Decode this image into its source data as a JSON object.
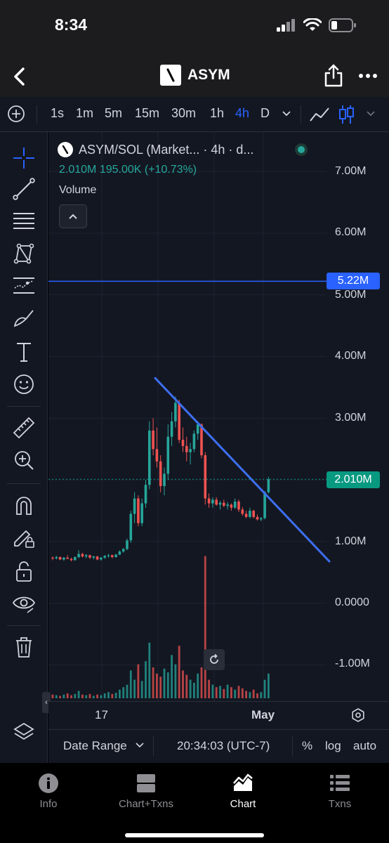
{
  "status": {
    "time": "8:34"
  },
  "nav": {
    "title": "ASYM"
  },
  "toolbar": {
    "timeframes": [
      "1s",
      "1m",
      "5m",
      "15m",
      "30m",
      "1h",
      "4h",
      "D"
    ],
    "active_timeframe": "4h"
  },
  "legend": {
    "title": "ASYM/SOL (Market... · 4h · d...",
    "values": "2.010M  195.00K (+10.73%)",
    "indicator": "Volume"
  },
  "y_axis": {
    "labels": [
      "7.00M",
      "6.00M",
      "5.00M",
      "4.00M",
      "3.00M",
      "1.00M",
      "0.0000",
      "-1.00M"
    ]
  },
  "price_tags": {
    "alert_line": "5.22M",
    "current_price": "2.010M"
  },
  "x_axis": {
    "labels": [
      "17",
      "May"
    ]
  },
  "bottom": {
    "date_range": "Date Range",
    "clock": "20:34:03 (UTC-7)",
    "percent": "%",
    "log": "log",
    "auto": "auto"
  },
  "tabs": [
    {
      "label": "Info",
      "icon": "info-icon"
    },
    {
      "label": "Chart+Txns",
      "icon": "split-view-icon"
    },
    {
      "label": "Chart",
      "icon": "chart-icon"
    },
    {
      "label": "Txns",
      "icon": "list-icon"
    }
  ],
  "active_tab": "Chart",
  "colors": {
    "up": "#26a69a",
    "down": "#ef5350",
    "accent": "#2962ff",
    "trendline": "#3d6ff0",
    "background": "#131722"
  },
  "chart_data": {
    "type": "candlestick",
    "symbol": "ASYM/SOL",
    "interval": "4h",
    "y_range": [
      -1500000,
      7700000
    ],
    "horizontal_line": 5220000,
    "current_price": 2010000,
    "candles": [
      [
        0.74,
        0.76,
        0.7,
        0.73
      ],
      [
        0.73,
        0.77,
        0.71,
        0.75
      ],
      [
        0.75,
        0.76,
        0.7,
        0.71
      ],
      [
        0.71,
        0.75,
        0.69,
        0.74
      ],
      [
        0.74,
        0.78,
        0.72,
        0.72
      ],
      [
        0.72,
        0.74,
        0.68,
        0.7
      ],
      [
        0.7,
        0.76,
        0.69,
        0.75
      ],
      [
        0.75,
        0.86,
        0.73,
        0.8
      ],
      [
        0.8,
        0.82,
        0.74,
        0.76
      ],
      [
        0.76,
        0.8,
        0.73,
        0.78
      ],
      [
        0.78,
        0.79,
        0.72,
        0.74
      ],
      [
        0.74,
        0.77,
        0.71,
        0.76
      ],
      [
        0.76,
        0.77,
        0.7,
        0.71
      ],
      [
        0.71,
        0.75,
        0.69,
        0.74
      ],
      [
        0.74,
        0.78,
        0.72,
        0.77
      ],
      [
        0.77,
        0.8,
        0.74,
        0.78
      ],
      [
        0.78,
        0.79,
        0.73,
        0.75
      ],
      [
        0.75,
        0.8,
        0.74,
        0.79
      ],
      [
        0.79,
        0.86,
        0.78,
        0.84
      ],
      [
        0.84,
        0.9,
        0.82,
        0.88
      ],
      [
        0.88,
        1.05,
        0.86,
        1.02
      ],
      [
        1.02,
        1.5,
        0.98,
        1.45
      ],
      [
        1.45,
        1.8,
        1.3,
        1.7
      ],
      [
        1.7,
        1.75,
        1.25,
        1.3
      ],
      [
        1.3,
        1.7,
        1.25,
        1.62
      ],
      [
        1.62,
        2.0,
        1.55,
        1.92
      ],
      [
        1.92,
        2.95,
        1.85,
        2.8
      ],
      [
        2.8,
        3.0,
        2.4,
        2.5
      ],
      [
        2.5,
        2.85,
        2.2,
        2.3
      ],
      [
        2.3,
        2.4,
        1.8,
        1.9
      ],
      [
        1.9,
        2.2,
        1.75,
        2.1
      ],
      [
        2.1,
        2.9,
        2.0,
        2.7
      ],
      [
        2.7,
        3.1,
        2.55,
        2.95
      ],
      [
        2.95,
        3.35,
        2.85,
        3.25
      ],
      [
        3.25,
        3.3,
        2.6,
        2.65
      ],
      [
        2.65,
        2.85,
        2.45,
        2.55
      ],
      [
        2.55,
        2.7,
        2.3,
        2.45
      ],
      [
        2.45,
        2.6,
        2.25,
        2.5
      ],
      [
        2.5,
        2.8,
        2.45,
        2.75
      ],
      [
        2.75,
        2.95,
        2.65,
        2.9
      ],
      [
        2.9,
        2.92,
        2.35,
        2.4
      ],
      [
        2.4,
        2.45,
        1.6,
        1.7
      ],
      [
        1.7,
        1.78,
        1.55,
        1.62
      ],
      [
        1.62,
        1.72,
        1.55,
        1.68
      ],
      [
        1.68,
        1.72,
        1.58,
        1.6
      ],
      [
        1.6,
        1.66,
        1.52,
        1.63
      ],
      [
        1.63,
        1.68,
        1.56,
        1.58
      ],
      [
        1.58,
        1.64,
        1.52,
        1.6
      ],
      [
        1.6,
        1.62,
        1.5,
        1.55
      ],
      [
        1.55,
        1.7,
        1.53,
        1.65
      ],
      [
        1.65,
        1.68,
        1.48,
        1.52
      ],
      [
        1.52,
        1.56,
        1.42,
        1.45
      ],
      [
        1.45,
        1.5,
        1.38,
        1.4
      ],
      [
        1.4,
        1.55,
        1.38,
        1.5
      ],
      [
        1.5,
        1.52,
        1.38,
        1.4
      ],
      [
        1.4,
        1.44,
        1.34,
        1.36
      ],
      [
        1.36,
        1.4,
        1.33,
        1.38
      ],
      [
        1.38,
        1.82,
        1.36,
        1.8
      ],
      [
        1.8,
        2.05,
        1.78,
        2.01
      ]
    ],
    "volume": [
      0.06,
      0.05,
      0.04,
      0.06,
      0.08,
      0.05,
      0.07,
      0.12,
      0.06,
      0.05,
      0.07,
      0.04,
      0.06,
      0.05,
      0.08,
      0.1,
      0.07,
      0.09,
      0.14,
      0.18,
      0.22,
      0.45,
      0.3,
      0.55,
      0.28,
      0.6,
      0.9,
      0.5,
      0.4,
      0.35,
      0.48,
      0.42,
      0.7,
      0.55,
      0.85,
      0.45,
      0.38,
      0.3,
      0.25,
      0.4,
      0.5,
      2.3,
      0.3,
      0.22,
      0.18,
      0.2,
      0.15,
      0.22,
      0.18,
      0.14,
      0.2,
      0.16,
      0.12,
      0.1,
      0.14,
      0.08,
      0.1,
      0.3,
      0.4
    ],
    "trendline": [
      [
        20,
        3650000
      ],
      [
        80,
        680000
      ]
    ]
  }
}
